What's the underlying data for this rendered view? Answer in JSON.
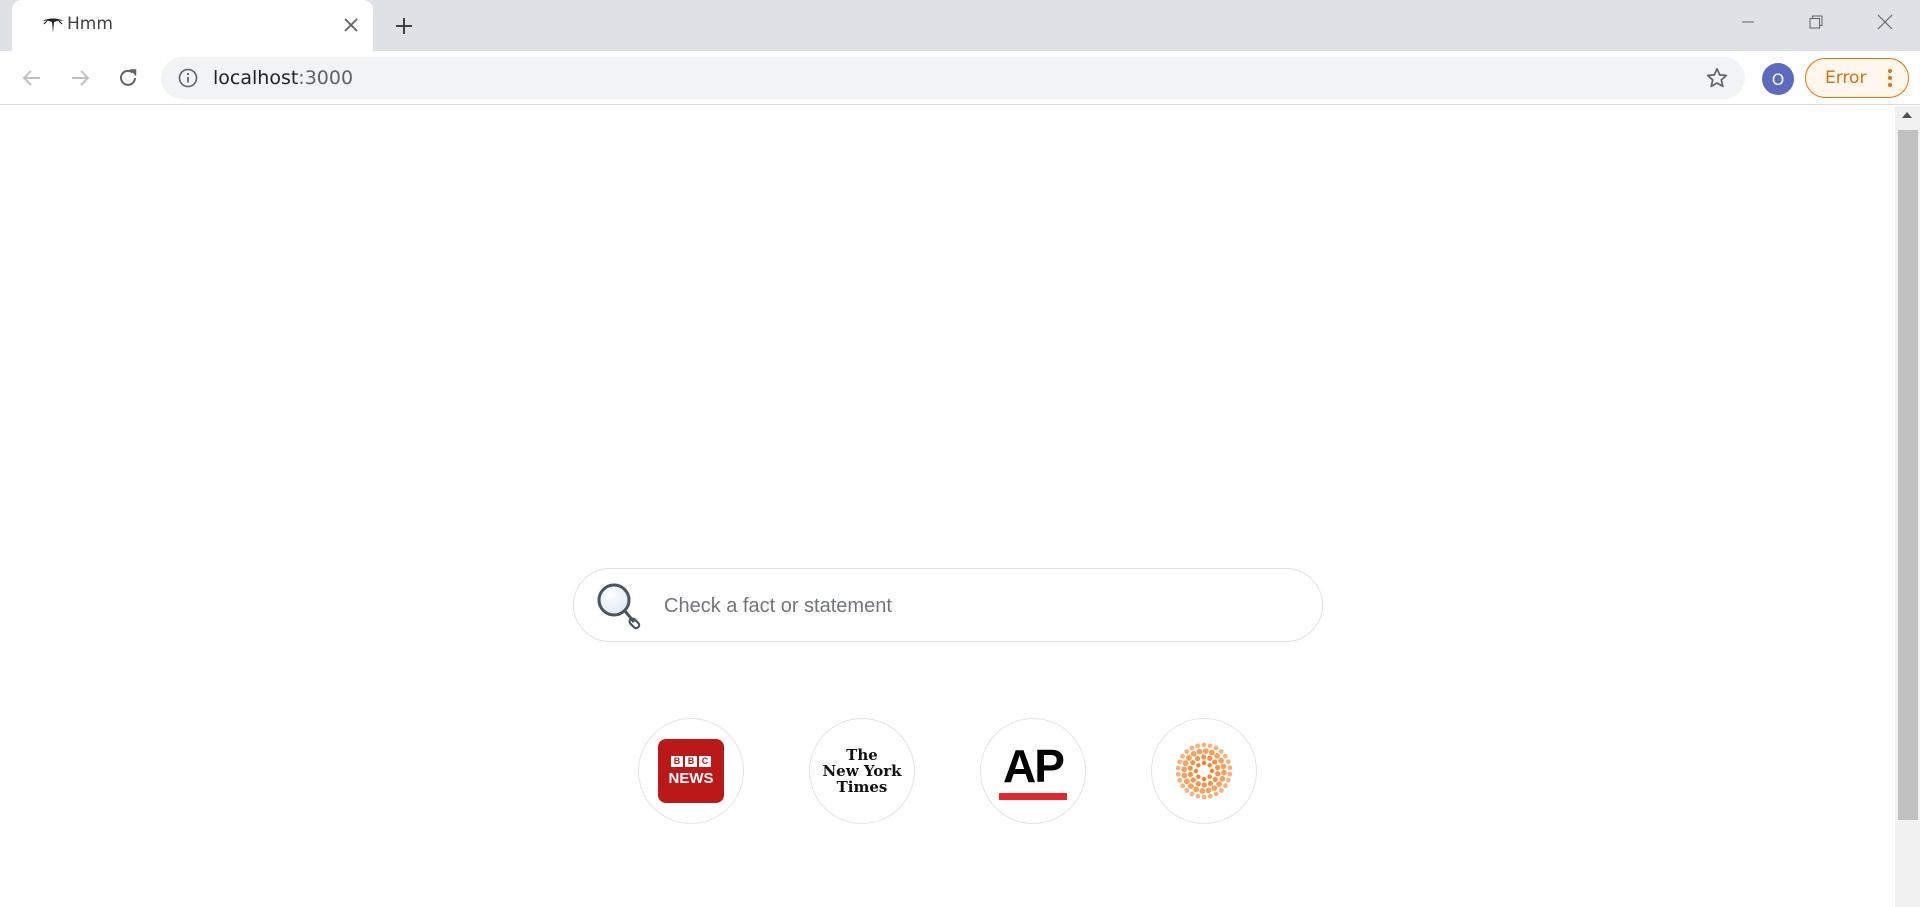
{
  "browser": {
    "tab": {
      "title": "Hmm"
    },
    "address": {
      "host": "localhost",
      "port": ":3000"
    },
    "profile_initial": "O",
    "error_label": "Error"
  },
  "search": {
    "placeholder": "Check a fact or statement"
  },
  "sources": [
    {
      "name": "BBC News",
      "blocks": [
        "B",
        "B",
        "C"
      ],
      "label": "NEWS"
    },
    {
      "name": "The New York Times",
      "lines": [
        "The",
        "New York",
        "Times"
      ]
    },
    {
      "name": "AP",
      "label": "AP"
    },
    {
      "name": "Reuters"
    }
  ],
  "colors": {
    "avatar": "#5c6bc0",
    "error_border": "#e37400",
    "bbc_red": "#bb1919",
    "ap_red": "#e0282e",
    "reuters_orange": "#f47b20"
  }
}
